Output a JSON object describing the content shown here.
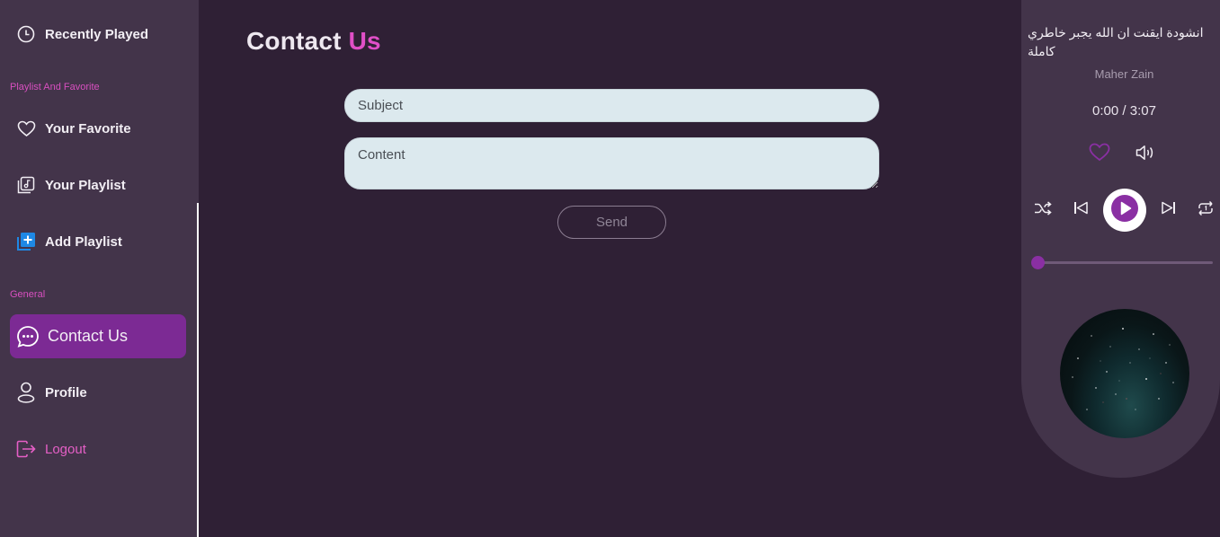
{
  "sidebar": {
    "recently_played": "Recently Played",
    "section_playlist": "Playlist And Favorite",
    "your_favorite": "Your Favorite",
    "your_playlist": "Your Playlist",
    "add_playlist": "Add Playlist",
    "section_general": "General",
    "contact_us": "Contact Us",
    "profile": "Profile",
    "logout": "Logout"
  },
  "main": {
    "title_part1": "Contact",
    "title_part2": "Us",
    "subject_placeholder": "Subject",
    "content_placeholder": "Content",
    "send_label": "Send"
  },
  "player": {
    "song_title": "انشودة ايقنت ان الله يجبر خاطري كاملة",
    "artist": "Maher Zain",
    "time": "0:00 / 3:07",
    "progress_fraction": 0
  },
  "colors": {
    "background": "#2f2035",
    "sidebar": "#43344a",
    "accent_pink": "#e04fc7",
    "active_purple": "#7c2a94",
    "add_icon_blue": "#1e88e5"
  }
}
